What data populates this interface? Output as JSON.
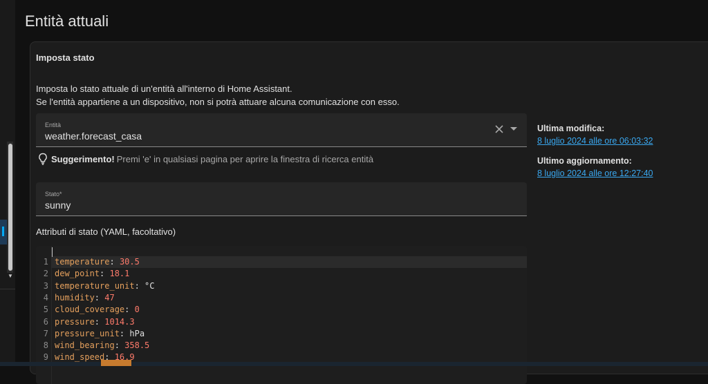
{
  "page": {
    "title": "Entità attuali"
  },
  "card": {
    "title": "Imposta stato",
    "description_line1": "Imposta lo stato attuale di un'entità all'interno di Home Assistant.",
    "description_line2": "Se l'entità appartiene a un dispositivo, non si potrà attuare alcuna comunicazione con esso."
  },
  "entity_field": {
    "label": "Entità",
    "value": "weather.forecast_casa"
  },
  "tip": {
    "bold": "Suggerimento!",
    "text": "Premi 'e' in qualsiasi pagina per aprire la finestra di ricerca entità"
  },
  "state_field": {
    "label": "Stato*",
    "value": "sunny"
  },
  "yaml": {
    "label": "Attributi di stato (YAML, facoltativo)",
    "lines": [
      {
        "num": "1",
        "key": "temperature",
        "value": "30.5",
        "type": "n"
      },
      {
        "num": "2",
        "key": "dew_point",
        "value": "18.1",
        "type": "n"
      },
      {
        "num": "3",
        "key": "temperature_unit",
        "value": "°C",
        "type": "s"
      },
      {
        "num": "4",
        "key": "humidity",
        "value": "47",
        "type": "n"
      },
      {
        "num": "5",
        "key": "cloud_coverage",
        "value": "0",
        "type": "n"
      },
      {
        "num": "6",
        "key": "pressure",
        "value": "1014.3",
        "type": "n"
      },
      {
        "num": "7",
        "key": "pressure_unit",
        "value": "hPa",
        "type": "s"
      },
      {
        "num": "8",
        "key": "wind_bearing",
        "value": "358.5",
        "type": "n"
      },
      {
        "num": "9",
        "key": "wind_speed",
        "value": "16.9",
        "type": "n"
      }
    ]
  },
  "meta": {
    "last_changed_label": "Ultima modifica:",
    "last_changed_value": "8 luglio 2024 alle ore 06:03:32",
    "last_updated_label": "Ultimo aggiornamento:",
    "last_updated_value": "8 luglio 2024 alle ore 12:27:40"
  },
  "colors": {
    "accent": "#03a9f4",
    "link": "#3aa8f0",
    "number": "#ff7b6b",
    "key": "#e5a05d"
  }
}
